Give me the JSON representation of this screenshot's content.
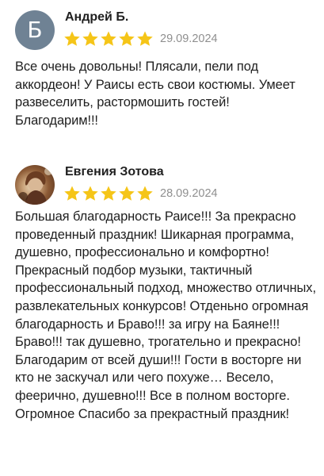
{
  "reviews": [
    {
      "author": "Андрей Б.",
      "avatar_letter": "Б",
      "rating": 5,
      "date": "29.09.2024",
      "text": "Все очень довольны! Плясали, пели под аккордеон! У Раисы есть свои костюмы. Умеет развеселить, растормошить гостей! Благодарим!!!"
    },
    {
      "author": "Евгения Зотова",
      "avatar_letter": "",
      "rating": 5,
      "date": "28.09.2024",
      "text": "Большая благодарность Раисе!!! За прекрасно проведенный праздник! Шикарная программа, душевно, профессионально и комфортно! Прекрасный подбор музыки, тактичный профессиональный подход, множество отличных, развлекательных конкурсов! Отденьно огромная благодарность и Браво!!! за игру на Баяне!!! Браво!!! так душевно, трогательно и прекрасно! Благодарим от всей души!!! Гости в восторге ни кто не заскучал или чего похуже… Весело, феерично, душевно!!! Все в полном восторге. Огромное Спасибо за прекрастный праздник!"
    }
  ],
  "colors": {
    "star": "#f5c518",
    "avatar_bg": "#6f8294",
    "date": "#8f8f8f"
  },
  "icons": {
    "star": "star-icon",
    "avatar_photo": "user-photo-avatar"
  }
}
